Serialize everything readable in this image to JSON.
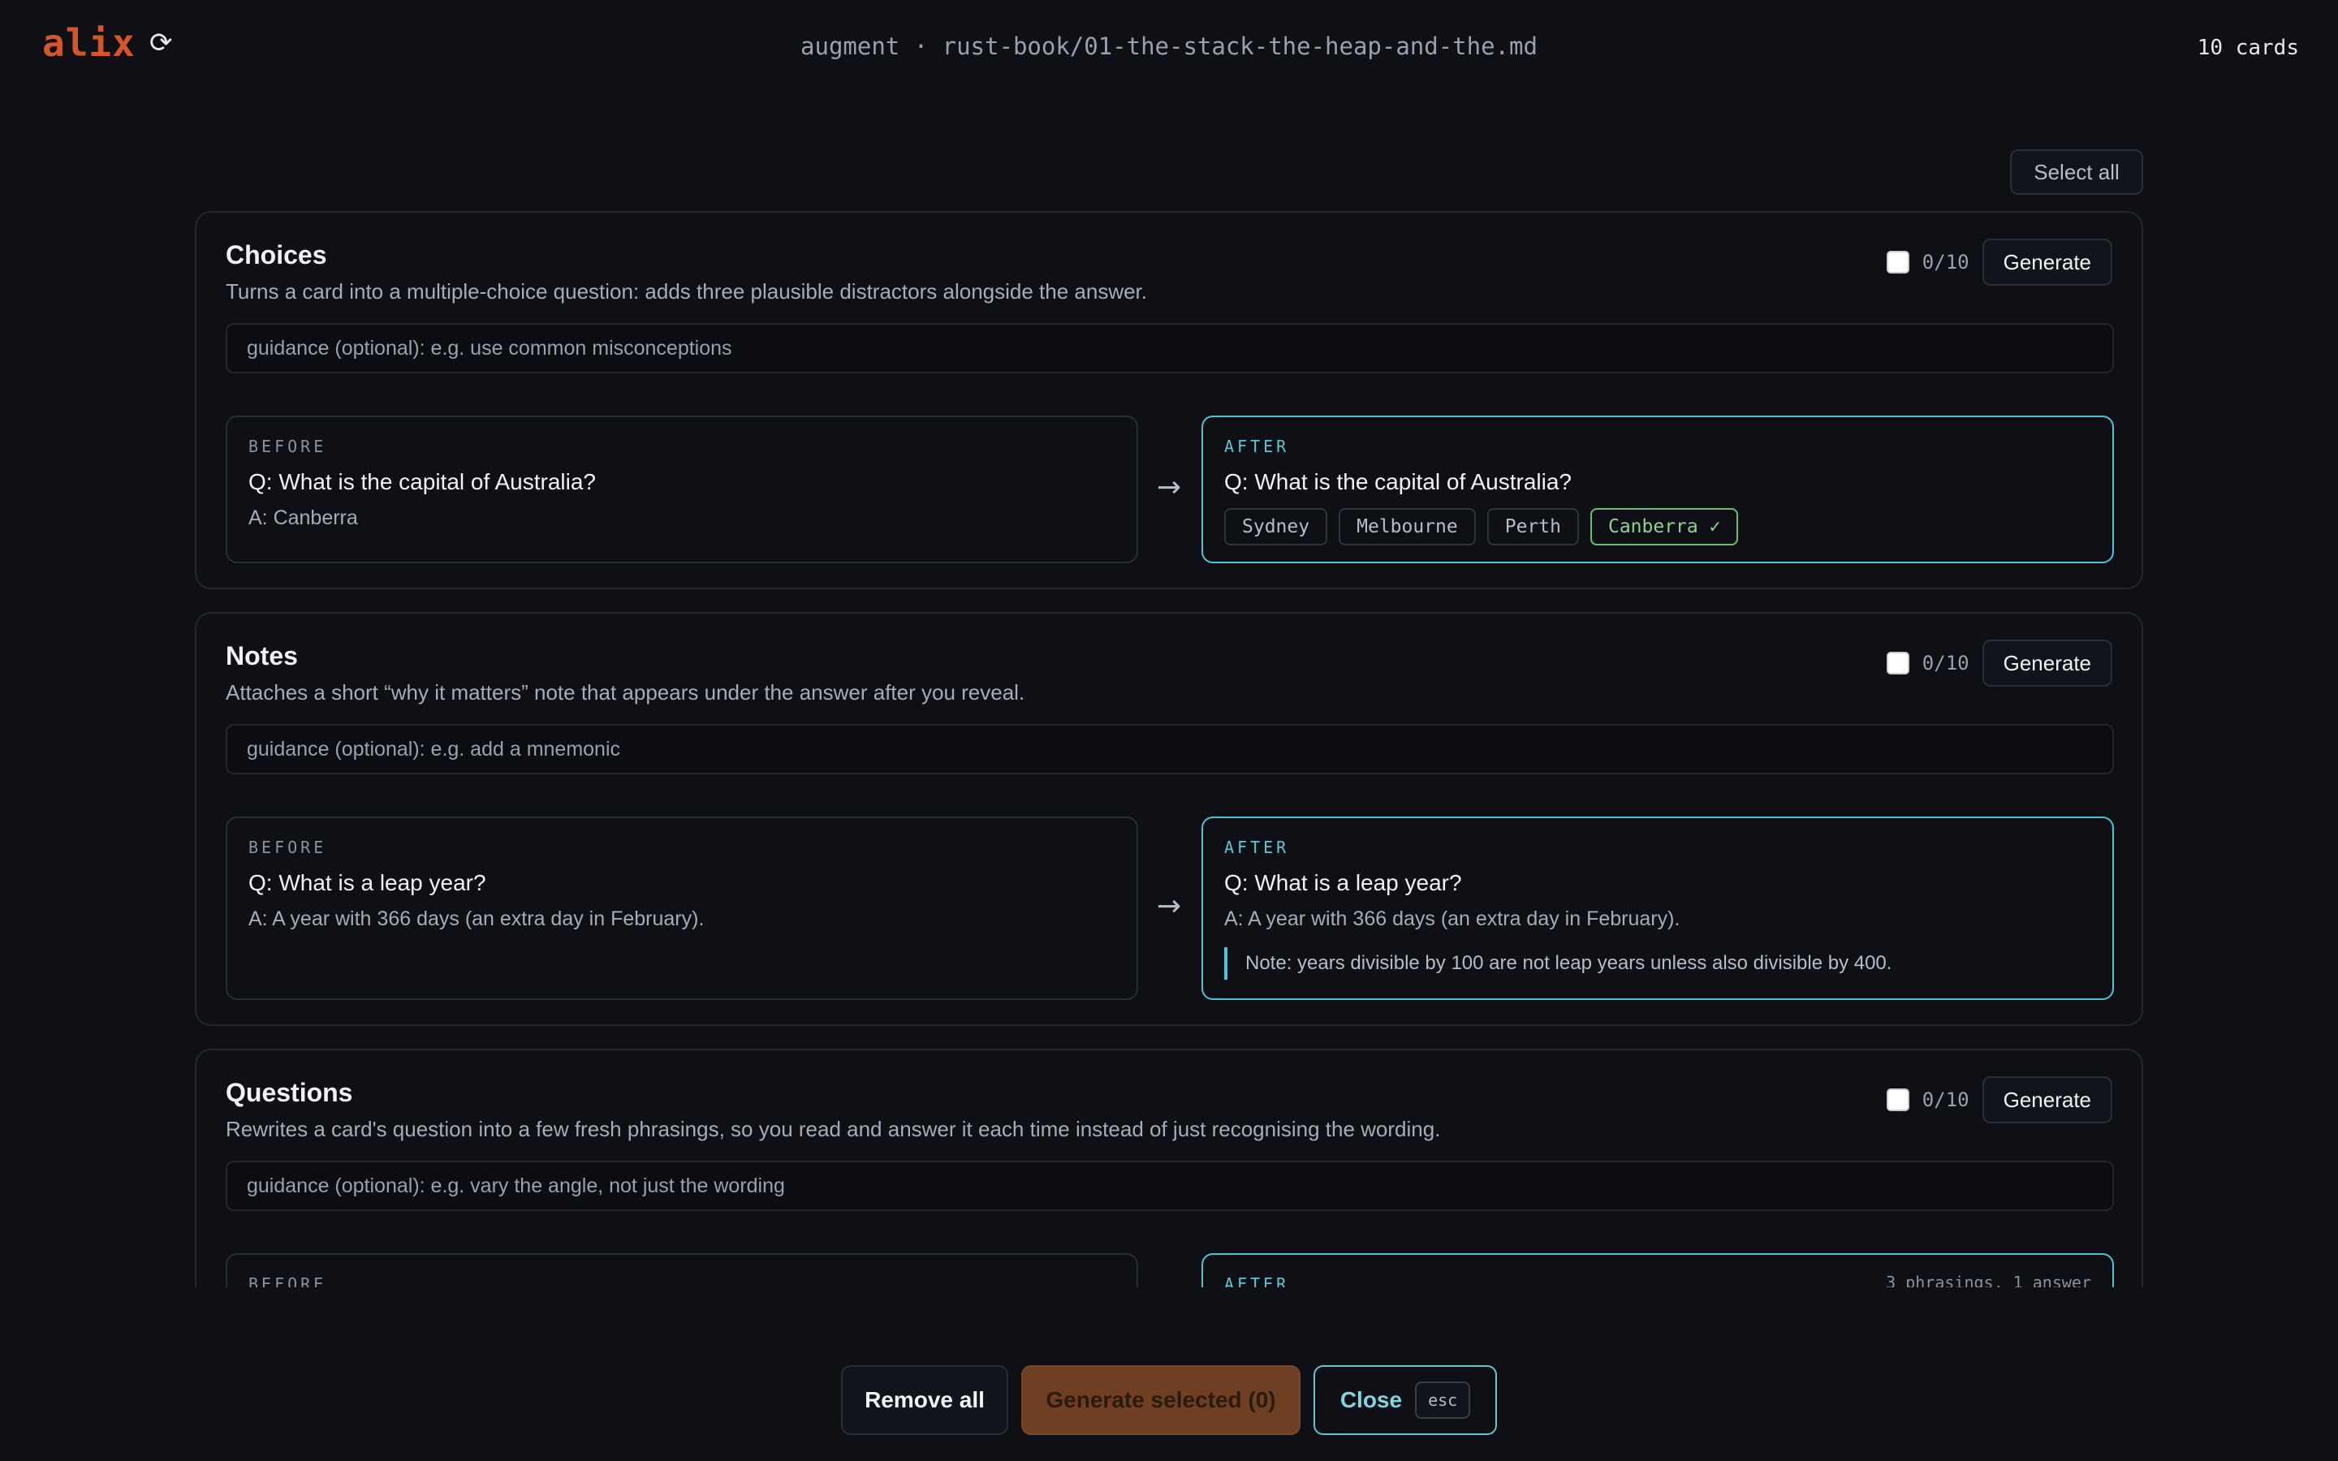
{
  "app": {
    "logo": "alix",
    "refresh_icon": "⟳",
    "breadcrumb": "augment · rust-book/01-the-stack-the-heap-and-the.md",
    "card_count": "10 cards"
  },
  "toolbar": {
    "select_all": "Select all"
  },
  "sections": [
    {
      "title": "Choices",
      "description": "Turns a card into a multiple-choice question: adds three plausible distractors alongside the answer.",
      "counter": "0/10",
      "generate": "Generate",
      "guidance_placeholder": "guidance (optional): e.g. use common misconceptions",
      "before": {
        "label": "BEFORE",
        "question": "Q: What is the capital of Australia?",
        "answer": "A: Canberra"
      },
      "after": {
        "label": "AFTER",
        "question": "Q: What is the capital of Australia?",
        "choices": [
          "Sydney",
          "Melbourne",
          "Perth"
        ],
        "correct": "Canberra ✓"
      }
    },
    {
      "title": "Notes",
      "description": "Attaches a short “why it matters” note that appears under the answer after you reveal.",
      "counter": "0/10",
      "generate": "Generate",
      "guidance_placeholder": "guidance (optional): e.g. add a mnemonic",
      "before": {
        "label": "BEFORE",
        "question": "Q: What is a leap year?",
        "answer": "A: A year with 366 days (an extra day in February)."
      },
      "after": {
        "label": "AFTER",
        "question": "Q: What is a leap year?",
        "answer": "A: A year with 366 days (an extra day in February).",
        "note": "Note: years divisible by 100 are not leap years unless also divisible by 400."
      }
    },
    {
      "title": "Questions",
      "description": "Rewrites a card's question into a few fresh phrasings, so you read and answer it each time instead of just recognising the wording.",
      "counter": "0/10",
      "generate": "Generate",
      "guidance_placeholder": "guidance (optional): e.g. vary the angle, not just the wording",
      "before": {
        "label": "BEFORE"
      },
      "after": {
        "label": "AFTER",
        "meta": "3 phrasings, 1 answer"
      }
    }
  ],
  "arrow": "→",
  "footer": {
    "remove_all": "Remove all",
    "generate_selected": "Generate selected (0)",
    "close": "Close",
    "close_key": "esc"
  },
  "colors": {
    "accent": "#d4562a",
    "teal": "#4fc3cf",
    "correct": "#6bbf73",
    "background": "#0e1016"
  }
}
